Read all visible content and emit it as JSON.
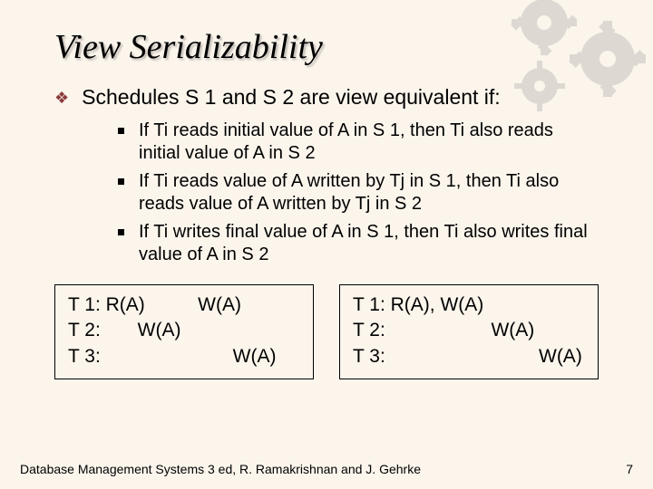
{
  "title": "View Serializability",
  "intro": "Schedules S 1 and S 2 are view equivalent if:",
  "conditions": [
    "If Ti reads initial value of A in S 1, then Ti also reads initial value of A in S 2",
    "If Ti reads value of A written by Tj in S 1, then Ti also reads value of A written by Tj in S 2",
    "If Ti writes final value of A in S 1, then Ti also writes final value of A in S 2"
  ],
  "schedule_left": {
    "r1": "T 1: R(A)          W(A)",
    "r2": "T 2:       W(A)",
    "r3": "T 3:                         W(A)"
  },
  "schedule_right": {
    "r1": "T 1: R(A), W(A)",
    "r2": "T 2:                    W(A)",
    "r3": "T 3:                             W(A)"
  },
  "footer_text": "Database Management Systems 3 ed, R. Ramakrishnan and J. Gehrke",
  "page_number": "7"
}
